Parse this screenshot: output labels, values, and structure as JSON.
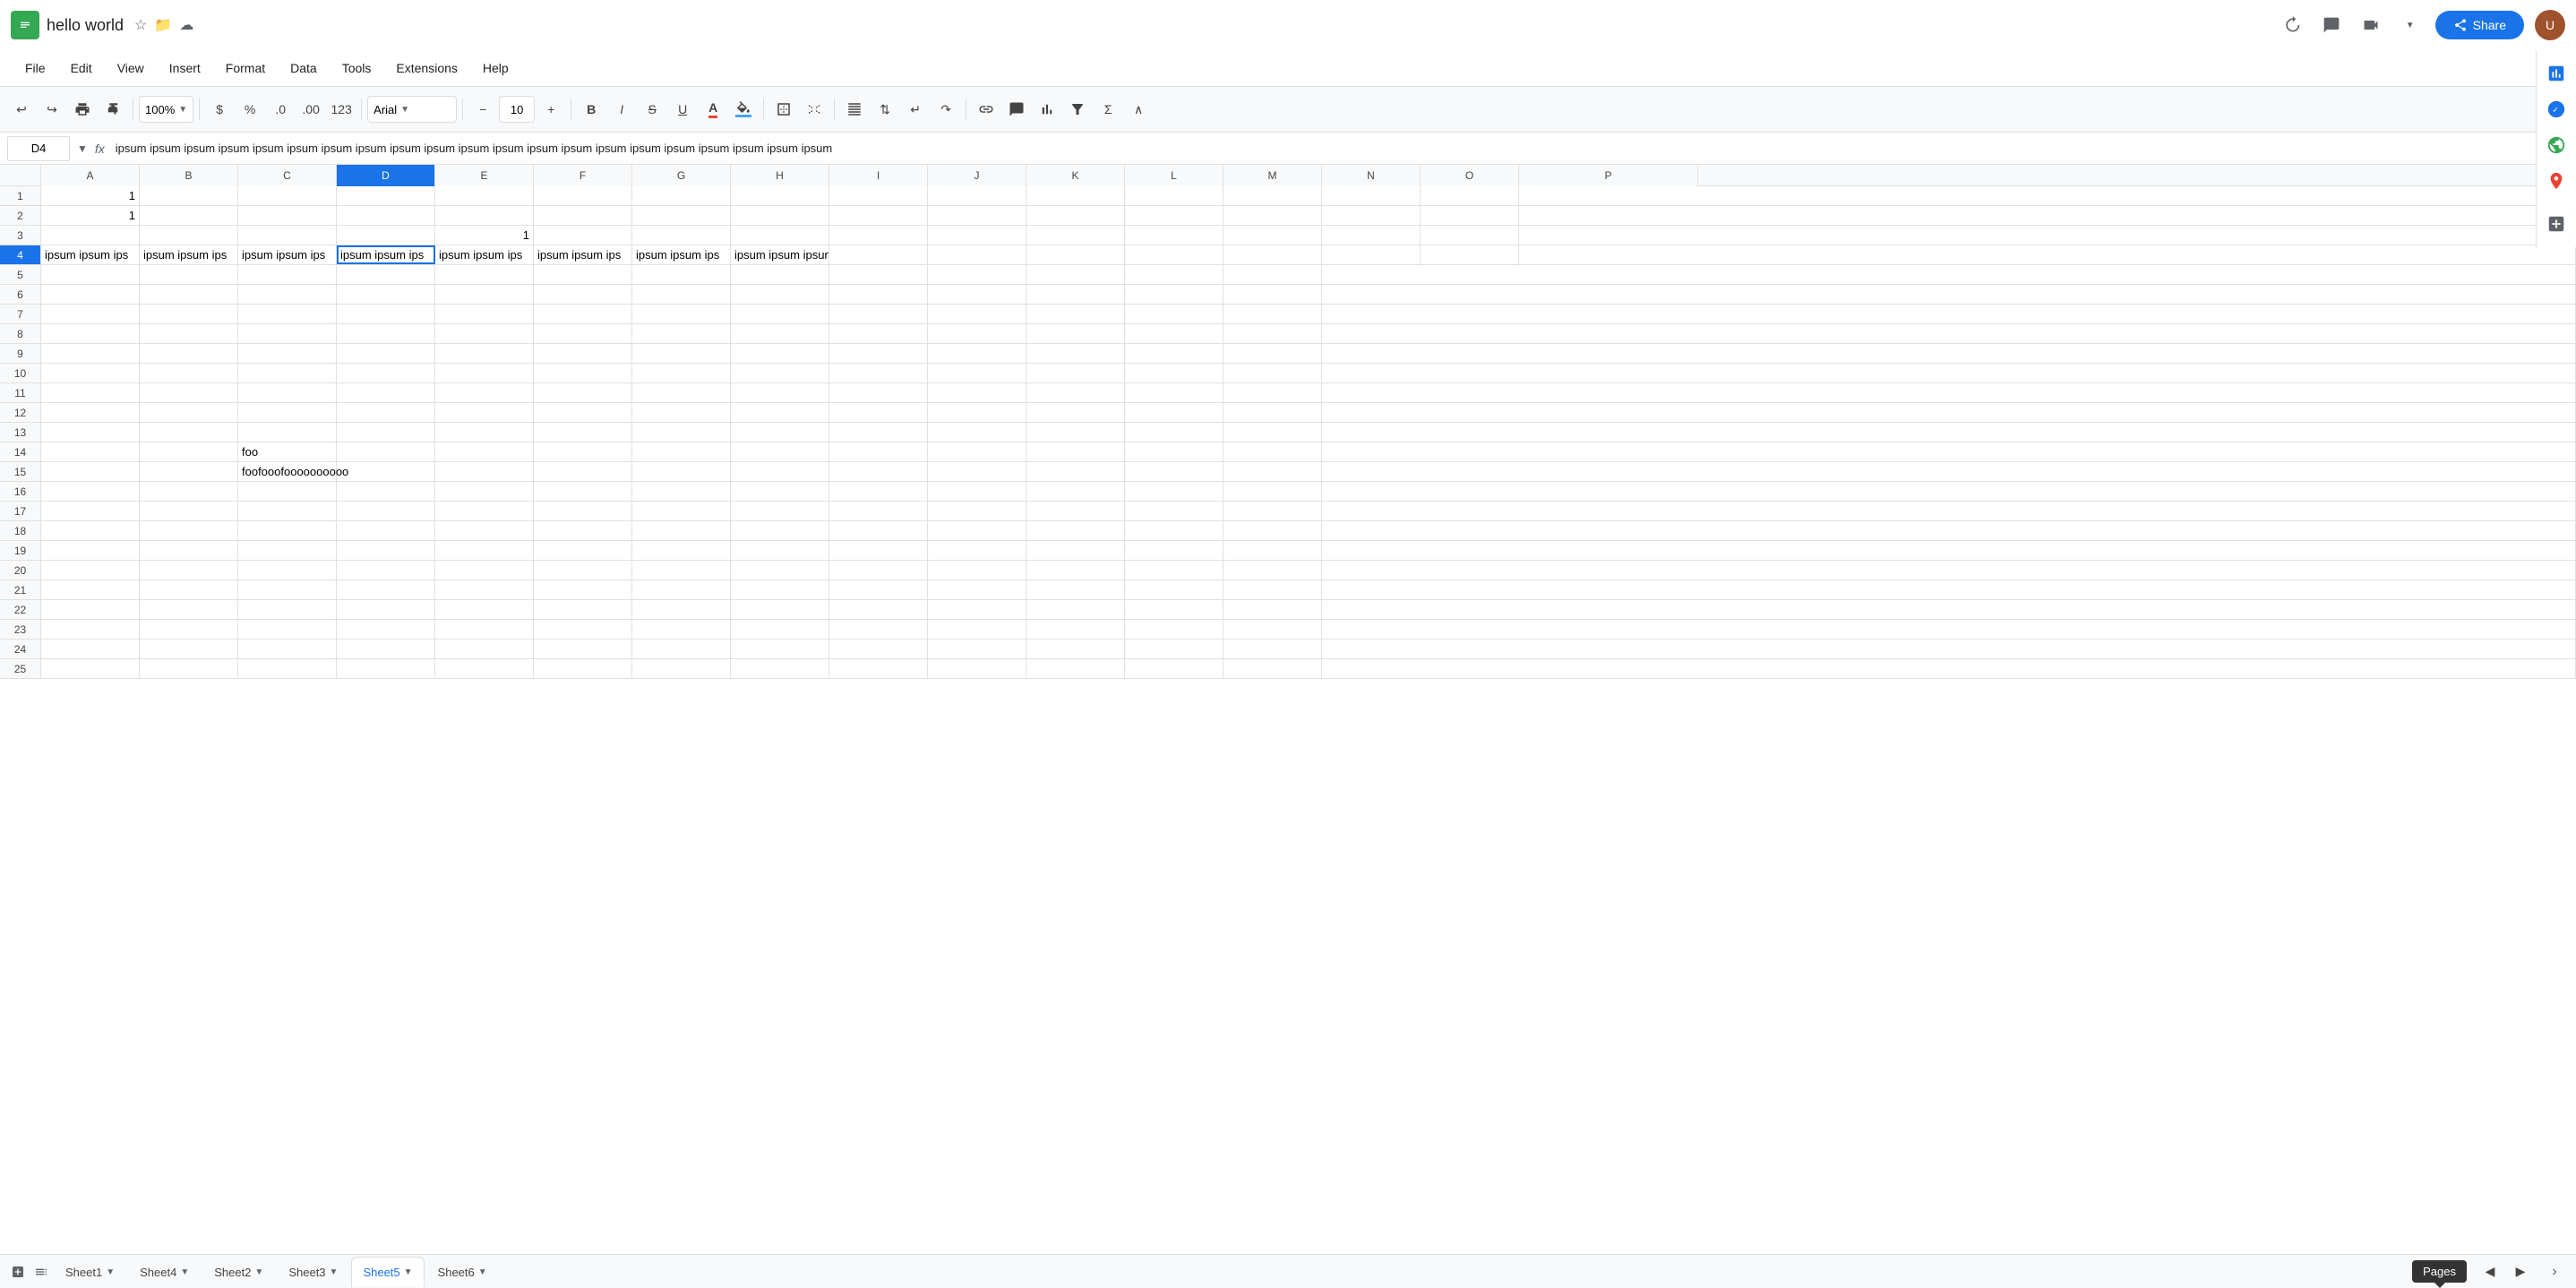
{
  "title_bar": {
    "app_name": "hello world",
    "share_label": "Share",
    "history_icon": "↺",
    "star_icon": "★",
    "folder_icon": "📁",
    "cloud_icon": "☁"
  },
  "menu": {
    "items": [
      "File",
      "Edit",
      "View",
      "Insert",
      "Format",
      "Data",
      "Tools",
      "Extensions",
      "Help"
    ]
  },
  "toolbar": {
    "undo_label": "↩",
    "redo_label": "↪",
    "print_label": "🖨",
    "paint_format": "🖌",
    "zoom_level": "100%",
    "currency": "$",
    "percent": "%",
    "dec_places": ".0",
    "inc_places": ".00",
    "format_123": "123",
    "font_name": "Arial",
    "font_size": "10",
    "minus_label": "−",
    "plus_label": "+",
    "bold_label": "B",
    "italic_label": "I",
    "strikethrough_label": "S",
    "underline_label": "U",
    "text_color": "A",
    "fill_color": "🎨",
    "borders_label": "⊞",
    "merge_label": "⊟",
    "align_label": "≡",
    "valign_label": "⇅",
    "wrap_label": "↵",
    "rotate_label": "↷",
    "link_label": "🔗",
    "comment_label": "💬",
    "chart_label": "📊",
    "filter_label": "▼",
    "formula_label": "Σ",
    "collapse_label": "∧"
  },
  "formula_bar": {
    "cell_ref": "D4",
    "formula_text": "ipsum ipsum ipsum ipsum ipsum ipsum ipsum ipsum ipsum ipsum ipsum ipsum ipsum ipsum ipsum ipsum ipsum ipsum ipsum ipsum ipsum"
  },
  "columns": [
    "A",
    "B",
    "C",
    "D",
    "E",
    "F",
    "G",
    "H",
    "I",
    "J",
    "K",
    "L",
    "M"
  ],
  "rows": {
    "count": 25,
    "data": {
      "1": {
        "A": "1",
        "col": "A"
      },
      "2": {
        "A": "1",
        "col": "A"
      },
      "3": {
        "E": "1",
        "col": "E"
      },
      "4": {
        "A": "ipsum ipsum ips",
        "B": "ipsum ipsum ips",
        "C": "ipsum ipsum ips",
        "D": "ipsum ipsum ips",
        "E": "ipsum ipsum ips",
        "F": "ipsum ipsum ips",
        "G": "ipsum ipsum ips",
        "H": "ipsum ipsum ipsum ipsum ipsum ipsum ipsum ipsum ipsum ipsum ipsum ipsum ipsum ipsum ipsum ipsum ipsum ipsum ipsum",
        "selected": "D"
      },
      "14": {
        "C": "foo"
      },
      "15": {
        "C": "foofooofoooooooooo"
      }
    }
  },
  "sheets": {
    "tabs": [
      {
        "name": "Sheet1",
        "active": false
      },
      {
        "name": "Sheet4",
        "active": false
      },
      {
        "name": "Sheet2",
        "active": false
      },
      {
        "name": "Sheet3",
        "active": false
      },
      {
        "name": "Sheet5",
        "active": true
      },
      {
        "name": "Sheet6",
        "active": false
      }
    ]
  },
  "tooltip": {
    "text": "Pages"
  },
  "right_panel": {
    "icons": [
      "chat",
      "explore",
      "maps",
      "add"
    ]
  }
}
